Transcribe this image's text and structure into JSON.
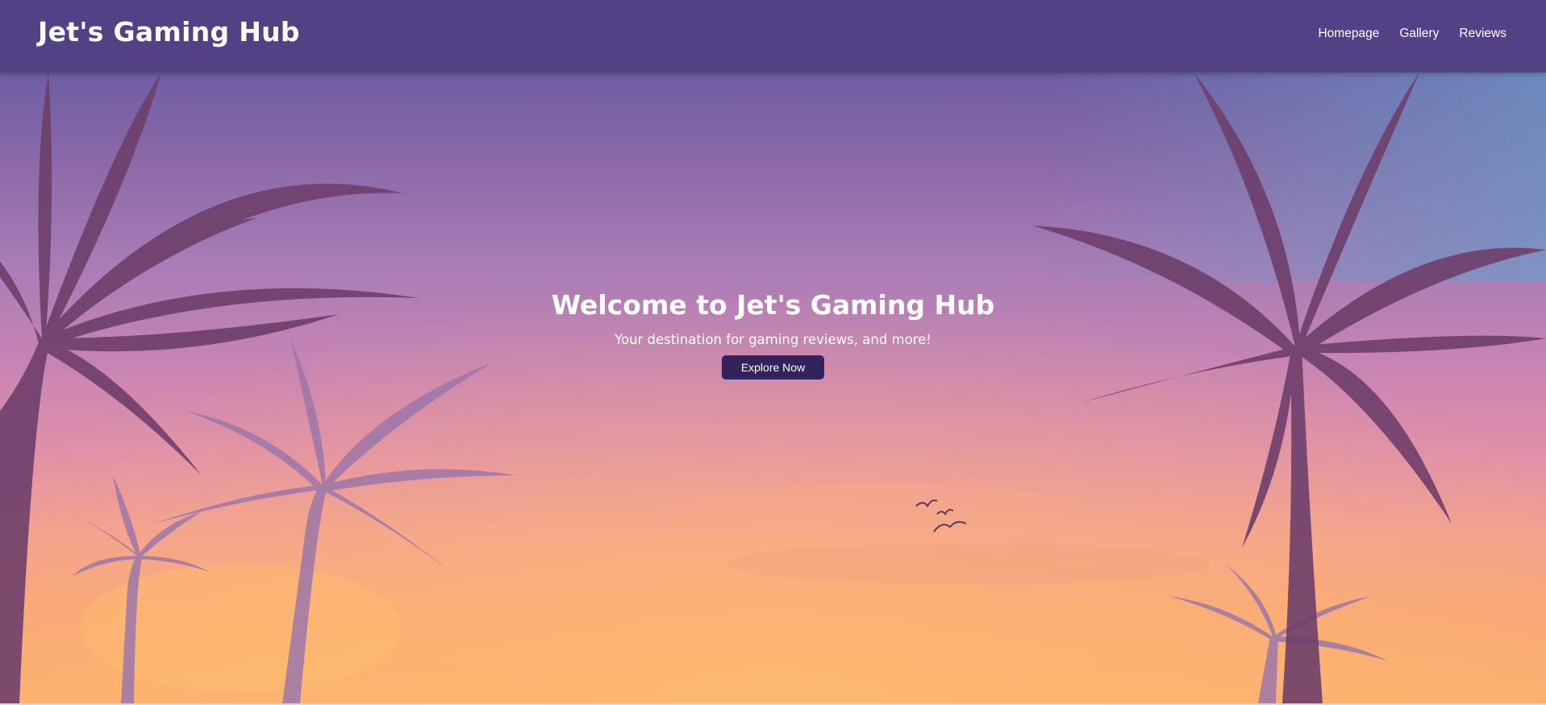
{
  "site": {
    "brand": "Jet's Gaming Hub"
  },
  "nav": {
    "items": [
      {
        "label": "Homepage"
      },
      {
        "label": "Gallery"
      },
      {
        "label": "Reviews"
      }
    ]
  },
  "hero": {
    "title": "Welcome to Jet's Gaming Hub",
    "subtitle": "Your destination for gaming reviews, and more!",
    "cta_label": "Explore Now",
    "background": "sunset-sky-with-palm-silhouettes"
  },
  "colors": {
    "header": "#534186",
    "cta": "#32235c",
    "text": "#ffffff"
  }
}
